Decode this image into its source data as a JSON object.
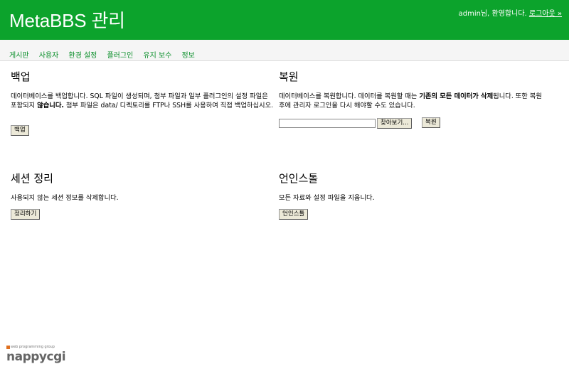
{
  "header": {
    "title": "MetaBBS 관리",
    "welcome": "admin님, 환영합니다.",
    "logout": "로그아웃 »"
  },
  "nav": {
    "items": [
      "게시판",
      "사용자",
      "환경 설정",
      "플러그인",
      "유지 보수",
      "정보"
    ]
  },
  "backup": {
    "title": "백업",
    "desc_a": "데이터베이스를 백업합니다. SQL 파일이 생성되며, 첨부 파일과 일부 플러그인의 설정 파일은 포함되지 ",
    "desc_bold": "않습니다.",
    "desc_b": " 첨부 파일은 data/ 디렉토리를 FTP나 SSH를 사용하여 직접 백업하십시오.",
    "button": "백업"
  },
  "restore": {
    "title": "복원",
    "desc_a": "데이터베이스를 복원합니다. 데이터를 복원할 때는 ",
    "desc_bold": "기존의 모든 데이터가 삭제",
    "desc_b": "됩니다. 또한 복원 후에 관리자 로그인을 다시 해야할 수도 있습니다.",
    "file_value": "",
    "browse": "찾아보기...",
    "button": "복원"
  },
  "session": {
    "title": "세션 정리",
    "desc": "사용되지 않는 세션 정보를 삭제합니다.",
    "button": "정리하기"
  },
  "uninstall": {
    "title": "언인스톨",
    "desc": "모든 자료와 설정 파일을 지웁니다.",
    "button": "언인스톨"
  },
  "footer": {
    "tagline": "web programming group",
    "logo": "nappycgi"
  },
  "colors": {
    "header_bg": "#0ca32c",
    "nav_link": "#0a8f2a"
  }
}
